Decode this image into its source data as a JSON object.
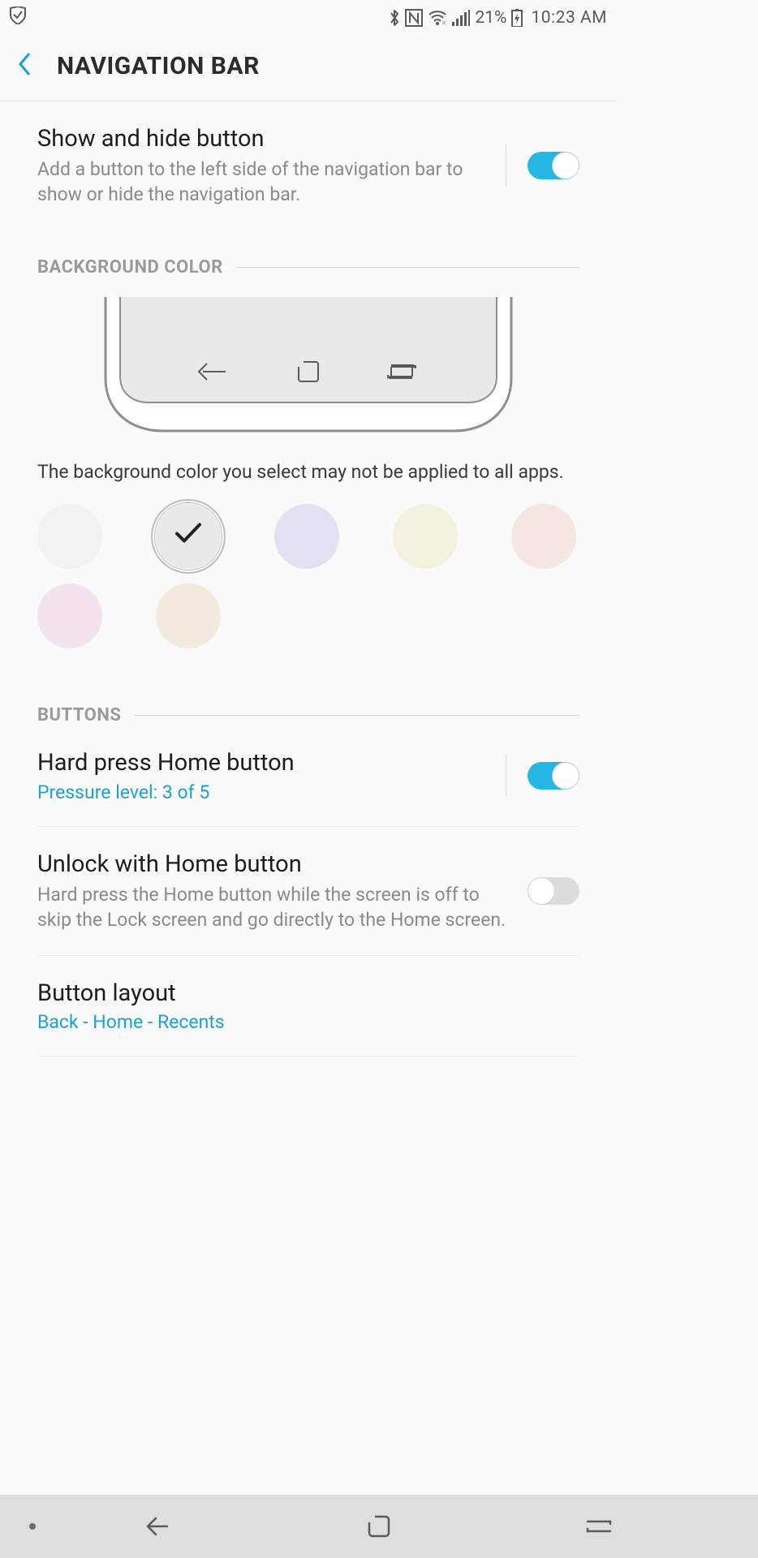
{
  "status": {
    "battery_text": "21%",
    "time": "10:23 AM"
  },
  "header": {
    "title": "NAVIGATION BAR"
  },
  "show_hide": {
    "title": "Show and hide button",
    "desc": "Add a button to the left side of the navigation bar to show or hide the navigation bar.",
    "enabled": true
  },
  "sections": {
    "bg_color": "BACKGROUND COLOR",
    "buttons": "BUTTONS"
  },
  "bg_color": {
    "caption": "The background color you select may not be applied to all apps.",
    "swatches": [
      {
        "name": "white",
        "color": "#f2f2f2",
        "selected": false
      },
      {
        "name": "light-grey",
        "color": "#e9e9e9",
        "selected": true
      },
      {
        "name": "lavender",
        "color": "#e0e1f3",
        "selected": false
      },
      {
        "name": "cream",
        "color": "#f4f2de",
        "selected": false
      },
      {
        "name": "blush",
        "color": "#f5e5e3",
        "selected": false
      },
      {
        "name": "pink",
        "color": "#f3e3ef",
        "selected": false
      },
      {
        "name": "peach",
        "color": "#f4e9dd",
        "selected": false
      }
    ]
  },
  "hard_press": {
    "title": "Hard press Home button",
    "sub": "Pressure level: 3 of 5",
    "enabled": true
  },
  "unlock_home": {
    "title": "Unlock with Home button",
    "desc": "Hard press the Home button while the screen is off to skip the Lock screen and go directly to the Home screen.",
    "enabled": false
  },
  "button_layout": {
    "title": "Button layout",
    "sub": "Back - Home - Recents"
  },
  "colors": {
    "accent": "#1e9fd6",
    "toggle_on": "#24b7e5"
  }
}
